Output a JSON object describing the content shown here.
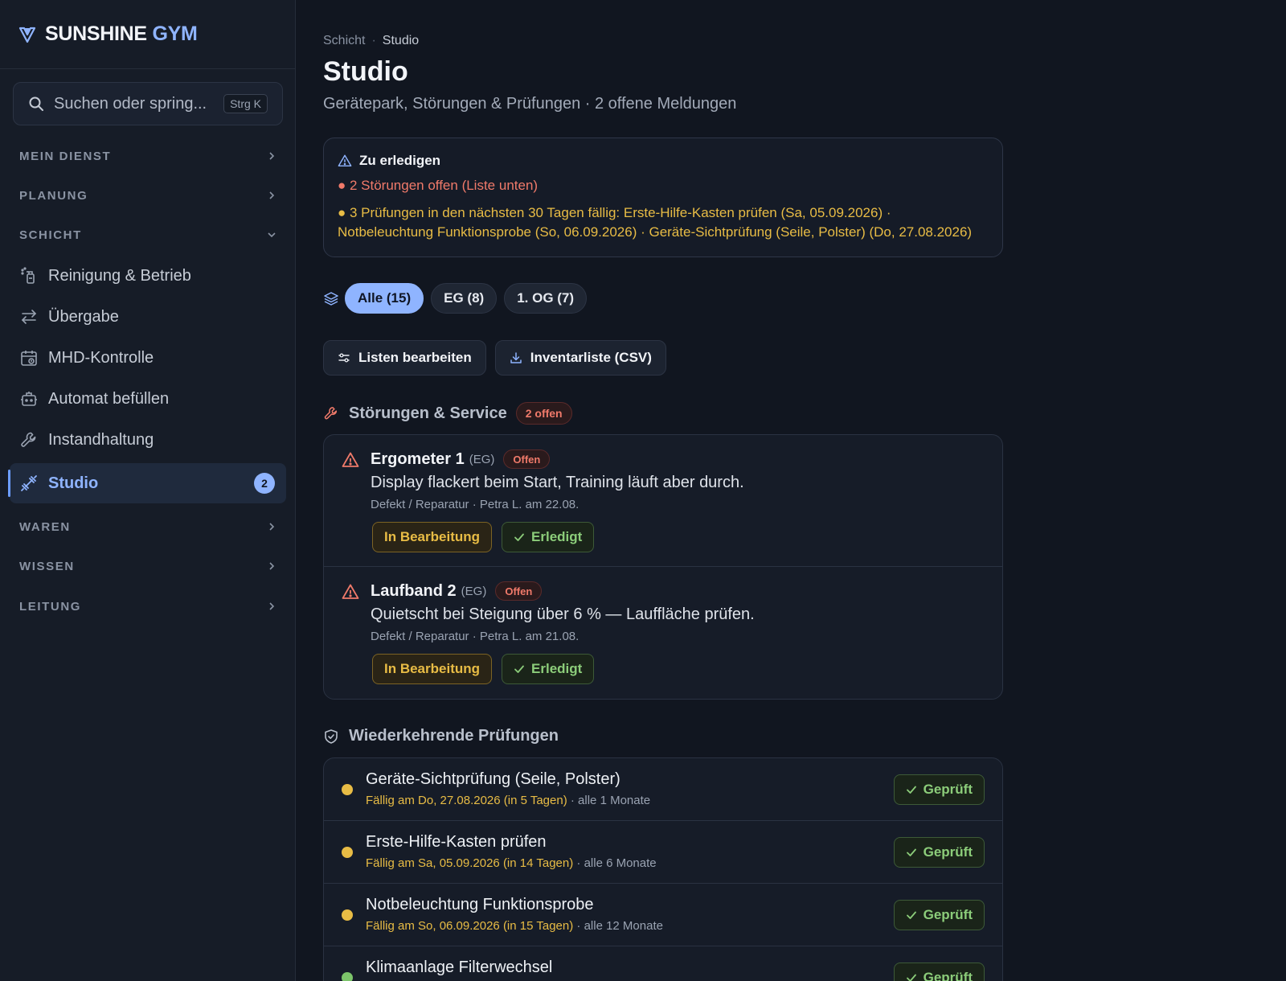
{
  "brand": {
    "name": "SUNSHINE",
    "accent": "GYM"
  },
  "search": {
    "placeholder": "Suchen oder spring...",
    "shortcut": "Strg K"
  },
  "nav": {
    "sections": [
      {
        "label": "MEIN DIENST",
        "expanded": false
      },
      {
        "label": "PLANUNG",
        "expanded": false
      },
      {
        "label": "SCHICHT",
        "expanded": true
      },
      {
        "label": "WAREN",
        "expanded": false
      },
      {
        "label": "WISSEN",
        "expanded": false
      },
      {
        "label": "LEITUNG",
        "expanded": false
      }
    ],
    "items": [
      {
        "label": "Reinigung & Betrieb",
        "icon": "spray-bottle-icon"
      },
      {
        "label": "Übergabe",
        "icon": "swap-arrows-icon"
      },
      {
        "label": "MHD-Kontrolle",
        "icon": "calendar-clock-icon"
      },
      {
        "label": "Automat befüllen",
        "icon": "vending-machine-icon"
      },
      {
        "label": "Instandhaltung",
        "icon": "wrench-icon"
      },
      {
        "label": "Studio",
        "icon": "dumbbell-icon",
        "badge": "2",
        "active": true
      }
    ]
  },
  "page": {
    "breadcrumb": [
      "Schicht",
      "Studio"
    ],
    "title": "Studio",
    "subtitle": "Gerätepark, Störungen & Prüfungen · 2 offene Meldungen"
  },
  "todo": {
    "title": "Zu erledigen",
    "red": "● 2 Störungen offen (Liste unten)",
    "yellow": "● 3 Prüfungen in den nächsten 30 Tagen fällig: Erste-Hilfe-Kasten prüfen (Sa, 05.09.2026) · Notbeleuchtung Funktionsprobe (So, 06.09.2026) · Geräte-Sichtprüfung (Seile, Polster) (Do, 27.08.2026)"
  },
  "filters": [
    {
      "label": "Alle (15)",
      "active": true
    },
    {
      "label": "EG (8)",
      "active": false
    },
    {
      "label": "1. OG (7)",
      "active": false
    }
  ],
  "actions": {
    "edit": "Listen bearbeiten",
    "export": "Inventarliste (CSV)"
  },
  "issues": {
    "title": "Störungen & Service",
    "count": "2 offen",
    "items": [
      {
        "name": "Ergometer 1",
        "zone": "(EG)",
        "status": "Offen",
        "desc": "Display flackert beim Start, Training läuft aber durch.",
        "meta": "Defekt / Reparatur · Petra L. am 22.08.",
        "progress": "In Bearbeitung",
        "done": "Erledigt"
      },
      {
        "name": "Laufband 2",
        "zone": "(EG)",
        "status": "Offen",
        "desc": "Quietscht bei Steigung über 6 % — Lauffläche prüfen.",
        "meta": "Defekt / Reparatur · Petra L. am 21.08.",
        "progress": "In Bearbeitung",
        "done": "Erledigt"
      }
    ]
  },
  "checks": {
    "title": "Wiederkehrende Prüfungen",
    "items": [
      {
        "name": "Geräte-Sichtprüfung (Seile, Polster)",
        "due": "Fällig am Do, 27.08.2026 (in 5 Tagen)",
        "interval": " · alle 1 Monate",
        "action": "Geprüft",
        "dot": "#e8bc45"
      },
      {
        "name": "Erste-Hilfe-Kasten prüfen",
        "due": "Fällig am Sa, 05.09.2026 (in 14 Tagen)",
        "interval": " · alle 6 Monate",
        "action": "Geprüft",
        "dot": "#e8bc45"
      },
      {
        "name": "Notbeleuchtung Funktionsprobe",
        "due": "Fällig am So, 06.09.2026 (in 15 Tagen)",
        "interval": " · alle 12 Monate",
        "action": "Geprüft",
        "dot": "#e8bc45"
      },
      {
        "name": "Klimaanlage Filterwechsel",
        "due": "",
        "interval": "",
        "action": "Geprüft",
        "dot": "#7cc46a"
      }
    ]
  },
  "colors": {
    "accent": "#8fb4ff",
    "danger": "#f07a6a",
    "warning": "#e8bc45",
    "success": "#8ccd7a"
  }
}
